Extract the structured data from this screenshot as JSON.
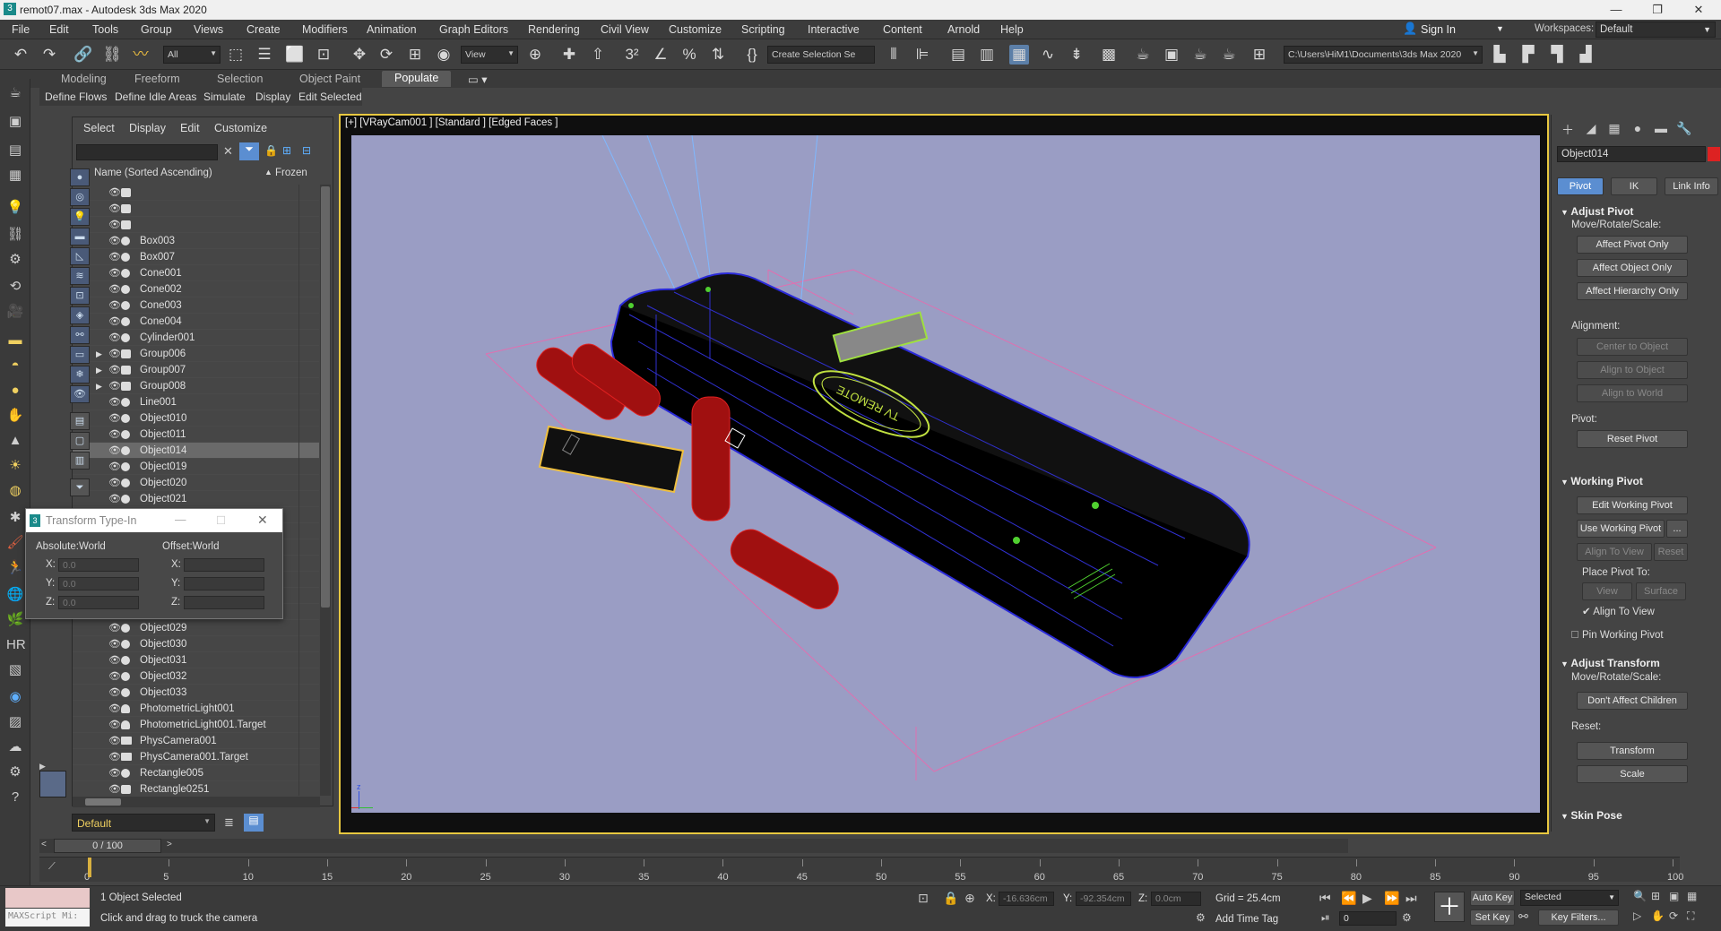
{
  "titlebar": {
    "title": "remot07.max - Autodesk 3ds Max 2020",
    "app_icon": "3"
  },
  "menu": [
    "File",
    "Edit",
    "Tools",
    "Group",
    "Views",
    "Create",
    "Modifiers",
    "Animation",
    "Graph Editors",
    "Rendering",
    "Civil View",
    "Customize",
    "Scripting",
    "Interactive",
    "Content",
    "Arnold",
    "Help"
  ],
  "account": {
    "sign_in": "Sign In",
    "workspaces_label": "Workspaces:",
    "workspace": "Default"
  },
  "toolbar": {
    "selection_filter": "All",
    "ref_coord": "View",
    "named_selection": "Create Selection Se",
    "project_path": "C:\\Users\\HiM1\\Documents\\3ds Max 2020"
  },
  "ribbon": {
    "tabs": [
      "Modeling",
      "Freeform",
      "Selection",
      "Object Paint",
      "Populate"
    ],
    "active_tab": "Populate",
    "sub": [
      "Define Flows",
      "Define Idle Areas",
      "Simulate",
      "Display",
      "Edit Selected"
    ]
  },
  "explorer": {
    "menu": [
      "Select",
      "Display",
      "Edit",
      "Customize"
    ],
    "col_name": "Name (Sorted Ascending)",
    "col_frozen": "Frozen",
    "sort_indicator": "▲",
    "rows": [
      {
        "name": "",
        "type": "group"
      },
      {
        "name": "",
        "type": "group"
      },
      {
        "name": "",
        "type": "group"
      },
      {
        "name": "Box003",
        "type": "geo"
      },
      {
        "name": "Box007",
        "type": "geo"
      },
      {
        "name": "Cone001",
        "type": "geo"
      },
      {
        "name": "Cone002",
        "type": "geo"
      },
      {
        "name": "Cone003",
        "type": "geo"
      },
      {
        "name": "Cone004",
        "type": "geo"
      },
      {
        "name": "Cylinder001",
        "type": "geo"
      },
      {
        "name": "Group006",
        "type": "group",
        "expand": true
      },
      {
        "name": "Group007",
        "type": "group",
        "expand": true
      },
      {
        "name": "Group008",
        "type": "group",
        "expand": true
      },
      {
        "name": "Line001",
        "type": "geo"
      },
      {
        "name": "Object010",
        "type": "geo"
      },
      {
        "name": "Object011",
        "type": "geo"
      },
      {
        "name": "Object014",
        "type": "geo",
        "selected": true
      },
      {
        "name": "Object019",
        "type": "geo"
      },
      {
        "name": "Object020",
        "type": "geo"
      },
      {
        "name": "Object021",
        "type": "geo"
      },
      {
        "name": "",
        "type": "geo"
      },
      {
        "name": "",
        "type": "geo"
      },
      {
        "name": "",
        "type": "geo"
      },
      {
        "name": "",
        "type": "geo"
      },
      {
        "name": "",
        "type": "geo"
      },
      {
        "name": "",
        "type": "geo"
      },
      {
        "name": "",
        "type": "geo"
      },
      {
        "name": "Object029",
        "type": "geo"
      },
      {
        "name": "Object030",
        "type": "geo"
      },
      {
        "name": "Object031",
        "type": "geo"
      },
      {
        "name": "Object032",
        "type": "geo"
      },
      {
        "name": "Object033",
        "type": "geo"
      },
      {
        "name": "PhotometricLight001",
        "type": "light"
      },
      {
        "name": "PhotometricLight001.Target",
        "type": "light"
      },
      {
        "name": "PhysCamera001",
        "type": "camera"
      },
      {
        "name": "PhysCamera001.Target",
        "type": "camera"
      },
      {
        "name": "Rectangle005",
        "type": "geo"
      },
      {
        "name": "Rectangle0251",
        "type": "group"
      }
    ],
    "layer": "Default"
  },
  "transform_typein": {
    "title": "Transform Type-In",
    "absolute_label": "Absolute:World",
    "offset_label": "Offset:World",
    "abs_x": "0.0",
    "abs_y": "0.0",
    "abs_z": "0.0",
    "off_x": "",
    "off_y": "",
    "off_z": ""
  },
  "viewport": {
    "label": "[+] [VRayCam001 ] [Standard ] [Edged Faces ]",
    "remote_text": "TV REMOTE"
  },
  "command_panel": {
    "object_name": "Object014",
    "object_color": "#dd2222",
    "tabs": [
      "Pivot",
      "IK",
      "Link Info"
    ],
    "active_tab": "Pivot",
    "adjust_pivot": {
      "title": "Adjust Pivot",
      "move_label": "Move/Rotate/Scale:",
      "affect_pivot_only": "Affect Pivot Only",
      "affect_object_only": "Affect Object Only",
      "affect_hierarchy_only": "Affect Hierarchy Only",
      "alignment_label": "Alignment:",
      "center_to_object": "Center to Object",
      "align_to_object": "Align to Object",
      "align_to_world": "Align to World",
      "pivot_label": "Pivot:",
      "reset_pivot": "Reset Pivot"
    },
    "working_pivot": {
      "title": "Working Pivot",
      "edit_working_pivot": "Edit Working Pivot",
      "use_working_pivot": "Use Working Pivot",
      "more": "...",
      "align_to_view": "Align To View",
      "reset": "Reset",
      "place_pivot_to": "Place Pivot To:",
      "view": "View",
      "surface": "Surface",
      "align_to_view_check": "Align To View",
      "pin_working_pivot": "Pin Working Pivot"
    },
    "adjust_transform": {
      "title": "Adjust Transform",
      "move_label": "Move/Rotate/Scale:",
      "dont_affect_children": "Don't Affect Children",
      "reset_label": "Reset:",
      "transform": "Transform",
      "scale": "Scale"
    },
    "skin_pose": {
      "title": "Skin Pose"
    }
  },
  "timeline": {
    "frame_display": "0 / 100",
    "ticks": [
      "0",
      "5",
      "10",
      "15",
      "20",
      "25",
      "30",
      "35",
      "40",
      "45",
      "50",
      "55",
      "60",
      "65",
      "70",
      "75",
      "80",
      "85",
      "90",
      "95",
      "100"
    ]
  },
  "status": {
    "maxscript": "MAXScript Mi:",
    "selection": "1 Object Selected",
    "prompt": "Click and drag to truck the camera",
    "x_label": "X:",
    "x_value": "-16.636cm",
    "y_label": "Y:",
    "y_value": "-92.354cm",
    "z_label": "Z:",
    "z_value": "0.0cm",
    "grid": "Grid = 25.4cm",
    "add_time_tag": "Add Time Tag",
    "auto_key": "Auto Key",
    "set_key": "Set Key",
    "selected_dd": "Selected",
    "key_filters": "Key Filters...",
    "frame_field": "0"
  }
}
